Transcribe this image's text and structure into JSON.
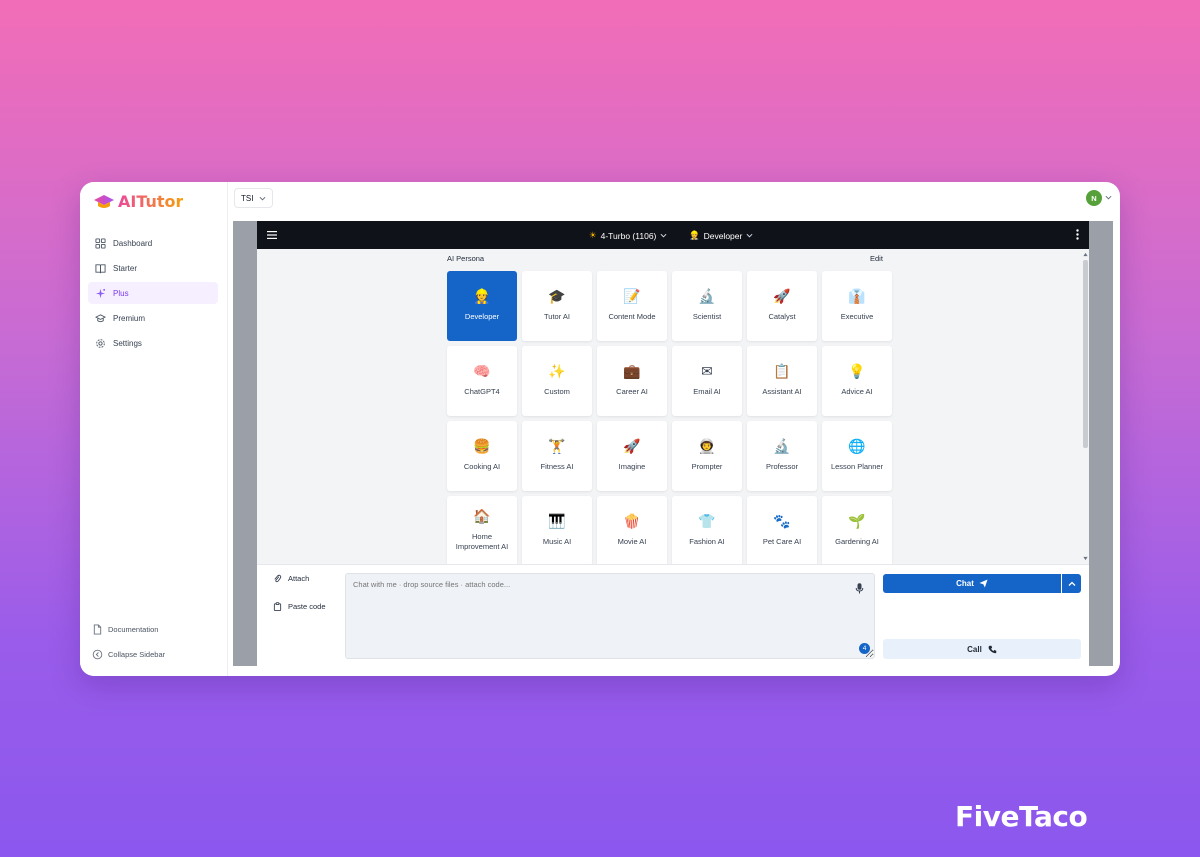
{
  "app": {
    "name": "AITutor",
    "workspace": "TSI",
    "avatar_initial": "N"
  },
  "sidebar": {
    "items": [
      {
        "label": "Dashboard",
        "icon": "grid-icon"
      },
      {
        "label": "Starter",
        "icon": "book-icon"
      },
      {
        "label": "Plus",
        "icon": "sparkles-icon",
        "active": true
      },
      {
        "label": "Premium",
        "icon": "graduation-cap-icon"
      },
      {
        "label": "Settings",
        "icon": "gear-icon"
      }
    ],
    "bottom": {
      "documentation": "Documentation",
      "collapse": "Collapse Sidebar"
    }
  },
  "header": {
    "model_icon": "☀",
    "model": "4-Turbo (1106)",
    "persona_icon": "👷",
    "persona": "Developer"
  },
  "persona_panel": {
    "title": "AI Persona",
    "edit": "Edit",
    "personas": [
      {
        "label": "Developer",
        "icon": "👷",
        "selected": true
      },
      {
        "label": "Tutor AI",
        "icon": "🎓"
      },
      {
        "label": "Content Mode",
        "icon": "📝"
      },
      {
        "label": "Scientist",
        "icon": "🔬"
      },
      {
        "label": "Catalyst",
        "icon": "🚀"
      },
      {
        "label": "Executive",
        "icon": "👔"
      },
      {
        "label": "ChatGPT4",
        "icon": "🧠"
      },
      {
        "label": "Custom",
        "icon": "✨"
      },
      {
        "label": "Career AI",
        "icon": "💼"
      },
      {
        "label": "Email AI",
        "icon": "✉"
      },
      {
        "label": "Assistant AI",
        "icon": "📋"
      },
      {
        "label": "Advice AI",
        "icon": "💡"
      },
      {
        "label": "Cooking AI",
        "icon": "🍔"
      },
      {
        "label": "Fitness AI",
        "icon": "🏋"
      },
      {
        "label": "Imagine",
        "icon": "🚀"
      },
      {
        "label": "Prompter",
        "icon": "👨‍🚀"
      },
      {
        "label": "Professor",
        "icon": "🔬"
      },
      {
        "label": "Lesson Planner",
        "icon": "🌐"
      },
      {
        "label": "Home Improvement AI",
        "icon": "🏠"
      },
      {
        "label": "Music AI",
        "icon": "🎹"
      },
      {
        "label": "Movie AI",
        "icon": "🍿"
      },
      {
        "label": "Fashion AI",
        "icon": "👕"
      },
      {
        "label": "Pet Care AI",
        "icon": "🐾"
      },
      {
        "label": "Gardening AI",
        "icon": "🌱"
      }
    ]
  },
  "composer": {
    "attach": "Attach",
    "paste_code": "Paste code",
    "placeholder": "Chat with me · drop source files · attach code...",
    "badge_count": "4",
    "chat_button": "Chat",
    "call_button": "Call"
  },
  "watermark": "FiveTaco"
}
